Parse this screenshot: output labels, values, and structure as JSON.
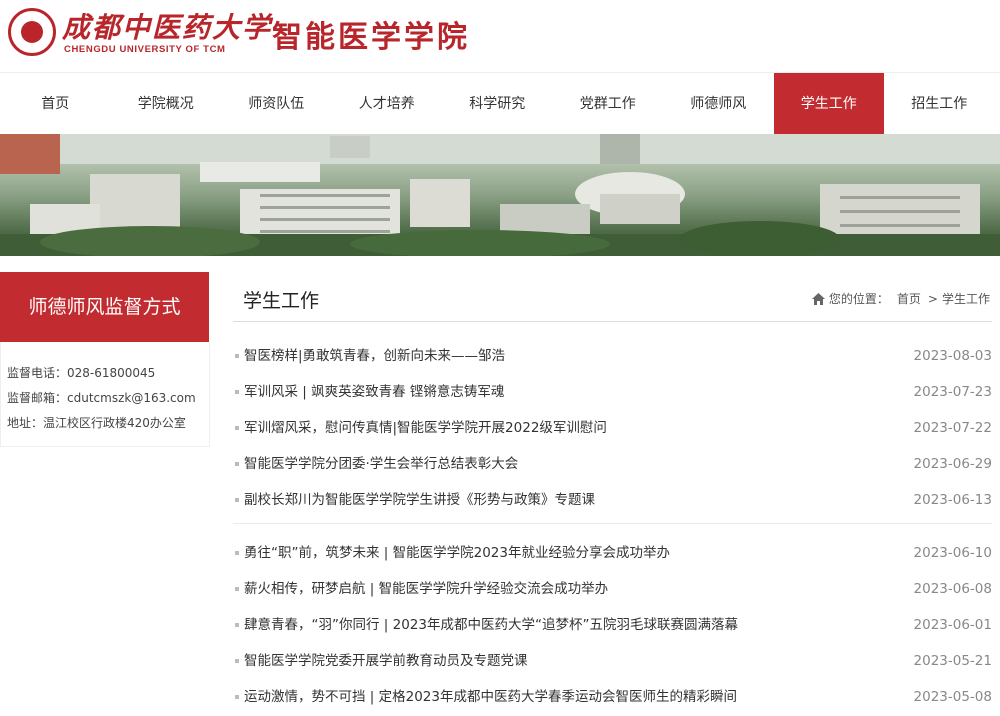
{
  "header": {
    "university_cn": "成都中医药大学",
    "university_en": "CHENGDU UNIVERSITY OF TCM",
    "college": "智能医学学院"
  },
  "nav": [
    {
      "label": "首页"
    },
    {
      "label": "学院概况"
    },
    {
      "label": "师资队伍"
    },
    {
      "label": "人才培养"
    },
    {
      "label": "科学研究"
    },
    {
      "label": "党群工作"
    },
    {
      "label": "师德师风"
    },
    {
      "label": "学生工作",
      "active": true
    },
    {
      "label": "招生工作"
    }
  ],
  "sidebar": {
    "title": "师德师风监督方式",
    "lines": [
      "监督电话：028-61800045",
      "监督邮箱：cdutcmszk@163.com",
      "地址：温江校区行政楼420办公室"
    ]
  },
  "main": {
    "title": "学生工作",
    "breadcrumb": {
      "prefix": "您的位置：",
      "home": "首页",
      "sep": ">",
      "current": "学生工作"
    }
  },
  "news_groups": [
    [
      {
        "title": "智医榜样|勇敢筑青春，创新向未来——邹浩",
        "date": "2023-08-03"
      },
      {
        "title": "军训风采 | 飒爽英姿致青春 铿锵意志铸军魂",
        "date": "2023-07-23"
      },
      {
        "title": "军训熠风采，慰问传真情|智能医学学院开展2022级军训慰问",
        "date": "2023-07-22"
      },
      {
        "title": "智能医学学院分团委·学生会举行总结表彰大会",
        "date": "2023-06-29"
      },
      {
        "title": "副校长郑川为智能医学学院学生讲授《形势与政策》专题课",
        "date": "2023-06-13"
      }
    ],
    [
      {
        "title": "勇往“职”前，筑梦未来 | 智能医学学院2023年就业经验分享会成功举办",
        "date": "2023-06-10"
      },
      {
        "title": "薪火相传，研梦启航 | 智能医学学院升学经验交流会成功举办",
        "date": "2023-06-08"
      },
      {
        "title": "肆意青春，“羽”你同行 | 2023年成都中医药大学“追梦杯”五院羽毛球联赛圆满落幕",
        "date": "2023-06-01"
      },
      {
        "title": "智能医学学院党委开展学前教育动员及专题党课",
        "date": "2023-05-21"
      },
      {
        "title": "运动激情，势不可挡 | 定格2023年成都中医药大学春季运动会智医师生的精彩瞬间",
        "date": "2023-05-08"
      }
    ]
  ]
}
